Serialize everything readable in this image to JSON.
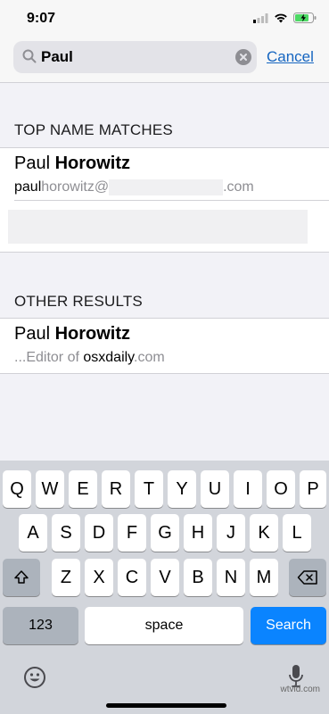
{
  "status": {
    "time": "9:07"
  },
  "search": {
    "query": "Paul",
    "cancel_label": "Cancel"
  },
  "sections": {
    "top": {
      "header": "TOP NAME MATCHES",
      "name_first": "Paul",
      "name_last": "Horowitz",
      "email_match": "paul",
      "email_rest": "horowitz@",
      "email_tail": ".com"
    },
    "other": {
      "header": "OTHER RESULTS",
      "name_first": "Paul",
      "name_last": "Horowitz",
      "snippet_prefix": "...Editor of ",
      "snippet_match": "osxdaily",
      "snippet_suffix": ".com"
    }
  },
  "keyboard": {
    "row1": [
      "Q",
      "W",
      "E",
      "R",
      "T",
      "Y",
      "U",
      "I",
      "O",
      "P"
    ],
    "row2": [
      "A",
      "S",
      "D",
      "F",
      "G",
      "H",
      "J",
      "K",
      "L"
    ],
    "row3": [
      "Z",
      "X",
      "C",
      "V",
      "B",
      "N",
      "M"
    ],
    "numbers_label": "123",
    "space_label": "space",
    "search_label": "Search"
  },
  "watermark": "wtvid.com",
  "colors": {
    "accent": "#0a84ff",
    "link": "#1565c0",
    "keyboard_bg": "#d2d5db"
  }
}
